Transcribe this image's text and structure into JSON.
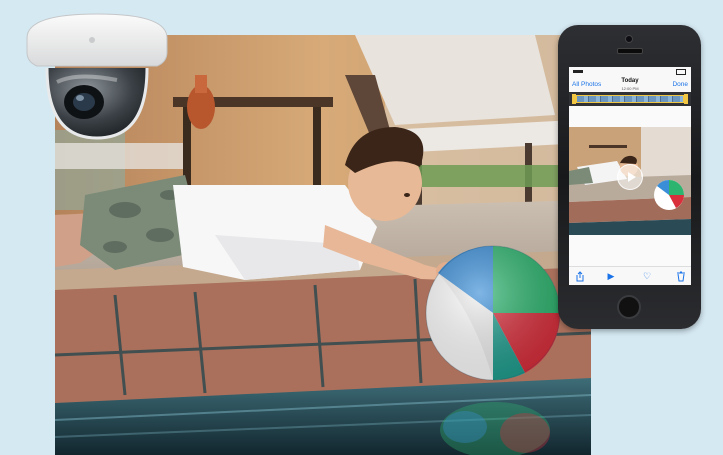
{
  "phone": {
    "nav": {
      "back_label": "All Photos",
      "title": "Today",
      "time": "12:00 PM",
      "done_label": "Done"
    },
    "toolbar": {
      "share_icon": "share-icon",
      "play_icon": "play-icon",
      "favorite_icon": "heart-icon",
      "delete_icon": "trash-icon",
      "play_glyph": "▶",
      "favorite_glyph": "♡"
    },
    "accent_color": "#1a73e8"
  },
  "colors": {
    "background": "#d5e9f3",
    "phone_body": "#1e1f22",
    "trim_handle": "#f2c744"
  }
}
